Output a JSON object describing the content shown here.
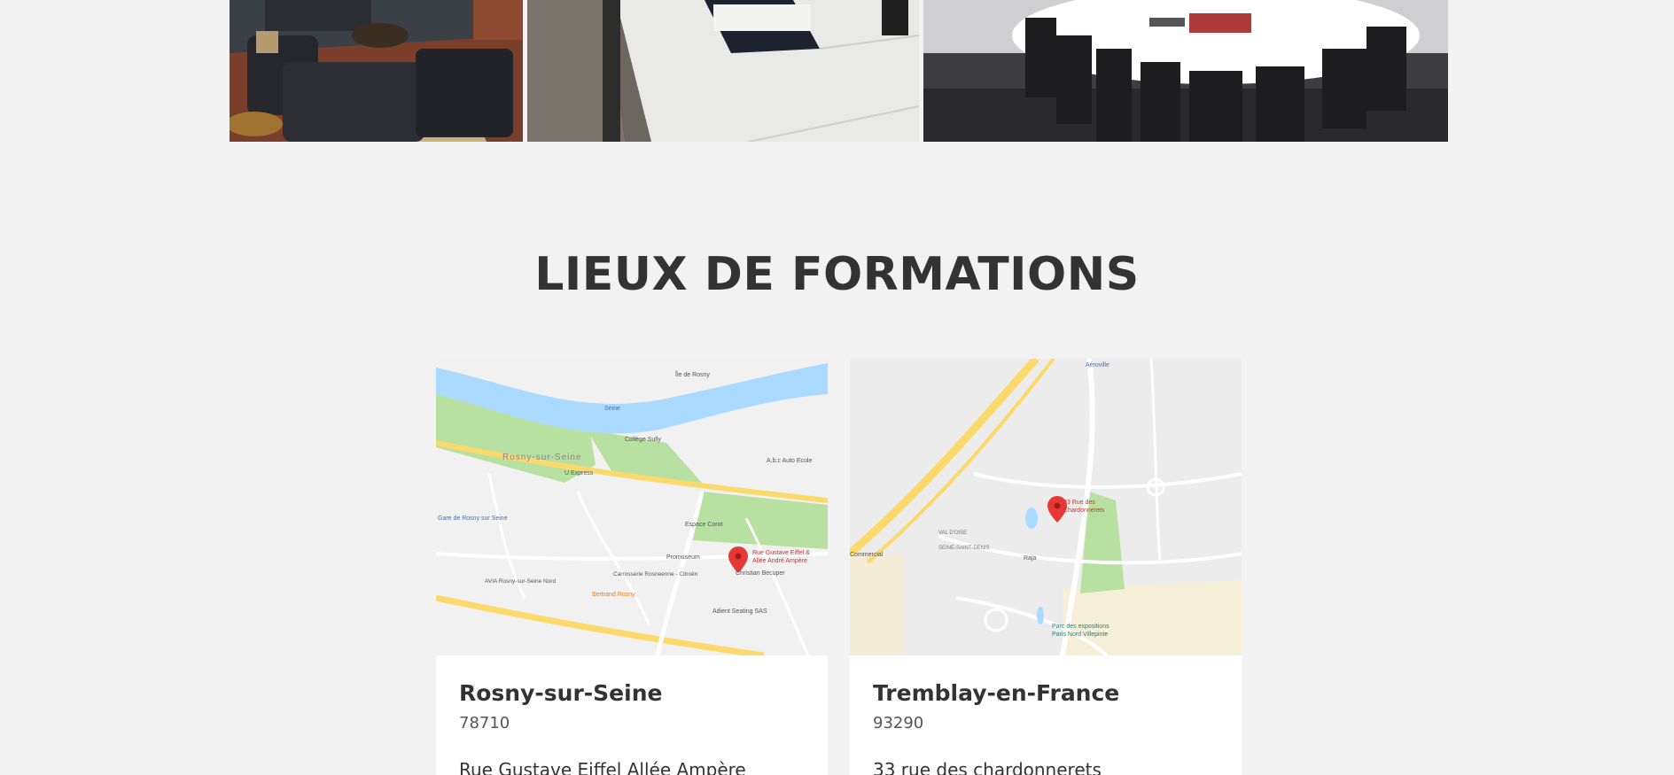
{
  "section": {
    "title": "LIEUX DE FORMATIONS"
  },
  "photos": [
    {
      "alt": "lounge-room"
    },
    {
      "alt": "training-room"
    },
    {
      "alt": "meeting-room"
    }
  ],
  "locations": [
    {
      "city": "Rosny-sur-Seine",
      "zip": "78710",
      "street": "Rue Gustave Eiffel Allée Ampère",
      "map": {
        "river_label": "Seine",
        "island_label": "Île de Rosny",
        "town_label": "Rosny-sur-Seine",
        "station_label": "Gare de Rosny sur Seine",
        "pin_label_1": "Rue Gustave Eiffel &",
        "pin_label_2": "Allée André Ampère",
        "poi_college": "Collège Sully",
        "poi_auto": "A.b.c Auto Ecole",
        "poi_express": "U Express",
        "poi_corot": "Espace Corot",
        "poi_promuseum": "Promuseum",
        "poi_becuper": "Christian Becuper",
        "poi_carrosserie": "Carrosserie Rosneenne - Citroën",
        "poi_avia": "AVIA Rosny-sur-Seine Nord",
        "poi_bertrand": "Bertrand Rosny",
        "poi_adient": "Adient Seating SAS"
      }
    },
    {
      "city": "Tremblay-en-France",
      "zip": "93290",
      "street": "33 rue des chardonnerets",
      "map": {
        "pin_label_1": "33 Rue des",
        "pin_label_2": "Chardonnerets",
        "poi_aeroville": "Aéroville",
        "poi_raja": "Raja",
        "poi_parc_1": "Parc des expositions",
        "poi_parc_2": "Paris Nord Villepinte",
        "area_1": "VAL D'OISE",
        "area_2": "SEINE-SAINT-DENIS",
        "poi_commercial": "Commercial"
      }
    }
  ],
  "colors": {
    "background": "#f2f2f2",
    "card": "#ffffff",
    "title": "#333333",
    "map_water": "#aadaff",
    "map_park": "#b8e0a0",
    "map_road_major": "#fcd96b",
    "map_land": "#f1f1f1",
    "pin": "#e53935"
  }
}
